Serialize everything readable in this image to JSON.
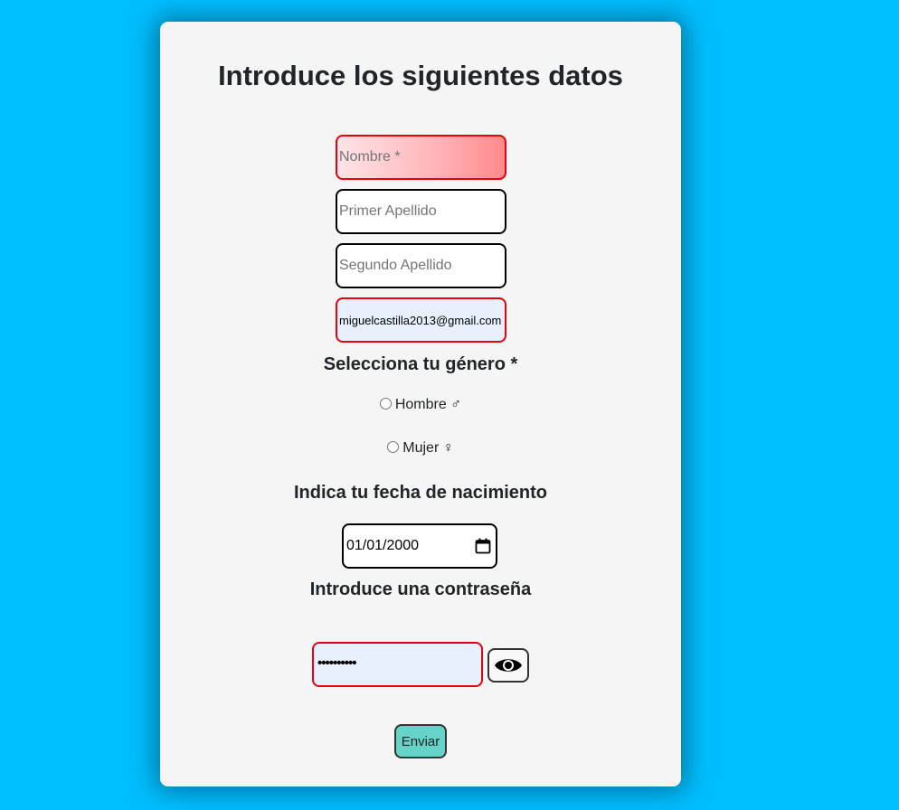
{
  "form": {
    "title": "Introduce los siguientes datos",
    "nombre_placeholder": "Nombre *",
    "apellido1_placeholder": "Primer Apellido",
    "apellido2_placeholder": "Segundo Apellido",
    "email_value": "miguelcastilla2013@gmail.com",
    "gender_label": "Selecciona tu género *",
    "gender_options": [
      {
        "label": "Hombre ♂",
        "checked": false
      },
      {
        "label": "Mujer ♀",
        "checked": false
      }
    ],
    "birthdate_label": "Indica tu fecha de nacimiento",
    "birthdate_value": "01/01/2000",
    "password_label": "Introduce una contraseña",
    "password_masked": "••••••••••",
    "submit_label": "Enviar"
  },
  "icons": {
    "calendar": "calendar-icon",
    "eye": "eye-icon"
  },
  "colors": {
    "background": "#00bfff",
    "card": "#f5f5f5",
    "invalid_border": "#e8000b",
    "autofill": "#e8f0fe",
    "submit": "#66d2c8"
  }
}
